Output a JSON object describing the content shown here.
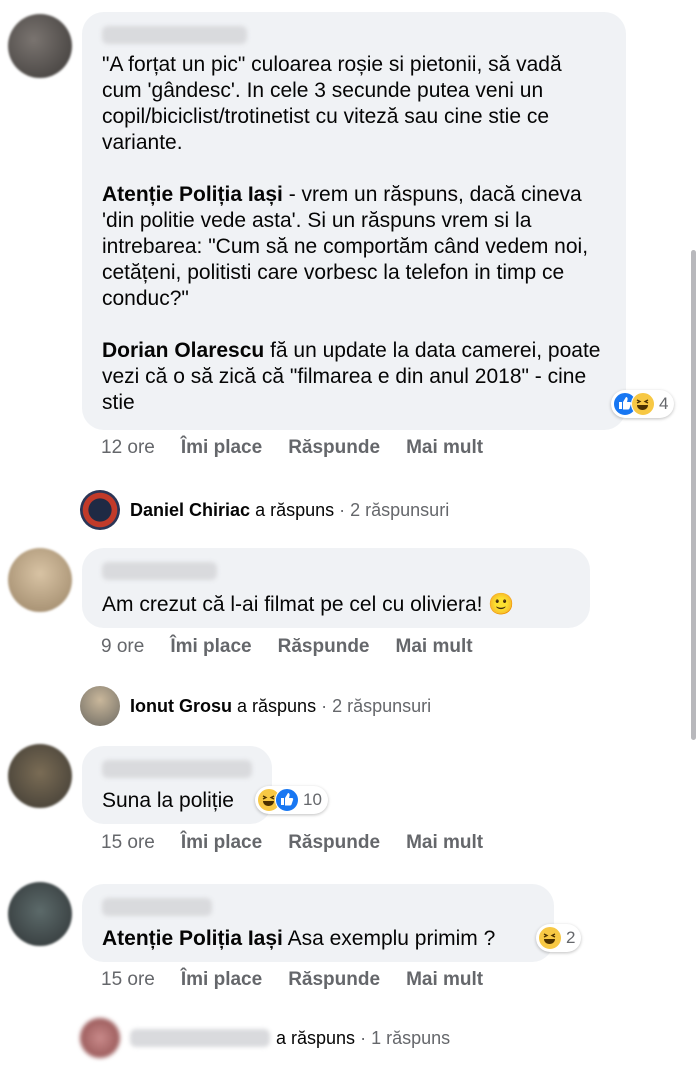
{
  "comments": [
    {
      "time": "12 ore",
      "paragraphs": [
        {
          "bold": "",
          "text": "\"A forțat un pic\" culoarea roșie si pietonii, să vadă cum 'gândesc'. In cele 3 secunde putea veni un copil/biciclist/trotinetist cu viteză sau cine stie ce variante."
        },
        {
          "bold": "Atenție Poliția Iași",
          "text": " - vrem un răspuns, dacă cineva 'din politie vede asta'. Si un răspuns vrem si la intrebarea: \"Cum să ne comportăm când vedem noi, cetățeni, politisti care vorbesc la telefon in timp ce conduc?\""
        },
        {
          "bold": "Dorian Olarescu",
          "text": " fă un update la data camerei, poate vezi că o să zică că \"filmarea e din anul 2018\" - cine stie"
        }
      ],
      "reactions": {
        "icons": [
          "like-icon",
          "haha-icon"
        ],
        "count": "4"
      },
      "reply_summary": {
        "name": "Daniel Chiriac",
        "verb": "a răspuns",
        "count": "· 2 răspunsuri"
      }
    },
    {
      "time": "9 ore",
      "text": "Am crezut că l-ai filmat pe cel cu oliviera! 🙂",
      "reply_summary": {
        "name": "Ionut Grosu",
        "verb": "a răspuns",
        "count": "· 2 răspunsuri"
      }
    },
    {
      "time": "15 ore",
      "text": "Suna la poliție",
      "reactions": {
        "icons": [
          "haha-icon",
          "like-icon"
        ],
        "count": "10"
      }
    },
    {
      "time": "15 ore",
      "bold": "Atenție Poliția Iași",
      "text": " Asa exemplu primim ?",
      "reactions": {
        "icons": [
          "haha-icon"
        ],
        "count": "2"
      },
      "reply_summary": {
        "name": "",
        "verb": "a răspuns",
        "count": "· 1 răspuns"
      }
    }
  ],
  "actions": {
    "like": "Îmi place",
    "reply": "Răspunde",
    "more": "Mai mult"
  },
  "colors": {
    "bubble": "#f0f2f5",
    "muted": "#65676b",
    "like": "#1877f2",
    "haha": "#f7c844"
  }
}
